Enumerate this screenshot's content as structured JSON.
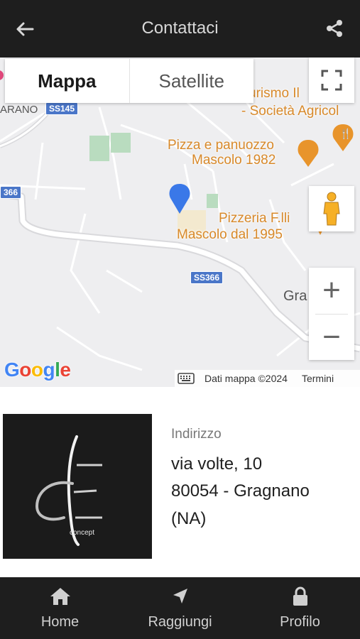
{
  "header": {
    "title": "Contattaci",
    "back_icon": "arrow-left-icon",
    "share_icon": "share-icon"
  },
  "map": {
    "map_type_options": [
      "Mappa",
      "Satellite"
    ],
    "selected_type": "Mappa",
    "labels": {
      "agriturismo": "urismo Il",
      "agriturismo_sub": "- Società Agricol",
      "pizza_line1": "Pizza e panuozzo",
      "pizza_line2": "Mascolo 1982",
      "pizzeria_line1": "Pizzeria F.lli",
      "pizzeria_line2": "Mascolo dal 1995",
      "town_left": "ARANO",
      "town_right": "Gra"
    },
    "roads": {
      "ss145": "SS145",
      "ss366_left": "366",
      "ss366_mid": "SS366"
    },
    "google_logo": "Google",
    "attribution": "Dati mappa ©2024",
    "terms": "Termini",
    "zoom_in": "+",
    "zoom_out": "−",
    "accent_pin": "#3a78e8",
    "poi_color": "#e8942b"
  },
  "contact": {
    "logo_text": "concept",
    "address_label": "Indirizzo",
    "address_line1": "via volte, 10",
    "address_line2": "80054 - Gragnano",
    "address_line3": "(NA)"
  },
  "bottom_nav": {
    "items": [
      {
        "label": "Home",
        "icon": "home-icon"
      },
      {
        "label": "Raggiungi",
        "icon": "navigation-arrow-icon"
      },
      {
        "label": "Profilo",
        "icon": "lock-icon"
      }
    ]
  }
}
